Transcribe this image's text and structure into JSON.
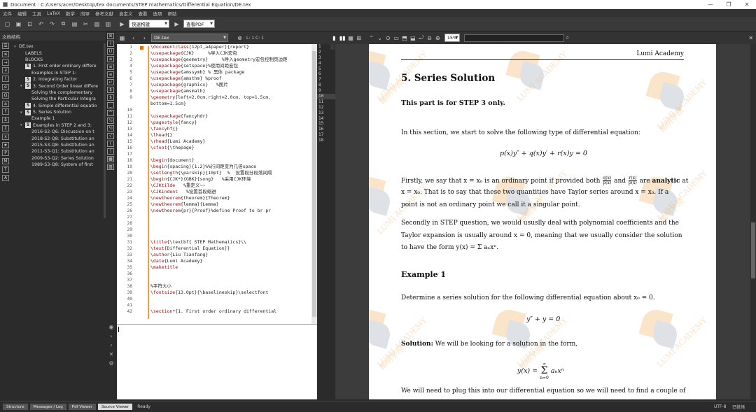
{
  "window": {
    "title": "Document : C:/Users/acer/Desktop/tex documents/STEP mathematics/Differential Equation/DE.tex"
  },
  "menu": [
    "文件",
    "编辑",
    "工具",
    "LaTeX",
    "数学",
    "向导",
    "参考文献",
    "自定义",
    "查看",
    "选项",
    "帮助"
  ],
  "toolbar": {
    "build_select": "快速构建",
    "view_select": "查看PDF"
  },
  "structure": {
    "header": "文档结构",
    "items": [
      {
        "level": 0,
        "caret": "▾",
        "icon": "",
        "label": "DE.tex"
      },
      {
        "level": 1,
        "caret": "",
        "icon": "",
        "label": "LABELS"
      },
      {
        "level": 1,
        "caret": "",
        "icon": "",
        "label": "BLOCKS"
      },
      {
        "level": 1,
        "caret": "",
        "icon": "S",
        "label": "1. First order ordinary differe"
      },
      {
        "level": 2,
        "caret": "",
        "icon": "",
        "label": "Examples in STEP 1:"
      },
      {
        "level": 1,
        "caret": "",
        "icon": "S",
        "label": "2. Integrating factor"
      },
      {
        "level": 1,
        "caret": "▾",
        "icon": "S",
        "label": "3. Second Order linear differe"
      },
      {
        "level": 2,
        "caret": "",
        "icon": "",
        "label": "Solving the complementary"
      },
      {
        "level": 2,
        "caret": "",
        "icon": "",
        "label": "Solving the Particular Integra"
      },
      {
        "level": 1,
        "caret": "",
        "icon": "S",
        "label": "4. Simple differential equatio"
      },
      {
        "level": 1,
        "caret": "▾",
        "icon": "S",
        "label": "5. Series Solution"
      },
      {
        "level": 2,
        "caret": "",
        "icon": "",
        "label": "Example 1"
      },
      {
        "level": 1,
        "caret": "▾",
        "icon": "S",
        "label": "Examples in STEP 2 and 3:"
      },
      {
        "level": 2,
        "caret": "",
        "icon": "",
        "label": "2016-S2-Q6: Discussion on t"
      },
      {
        "level": 2,
        "caret": "",
        "icon": "",
        "label": "2018-S2-Q8: Substitution an"
      },
      {
        "level": 2,
        "caret": "",
        "icon": "",
        "label": "2015-S3-Q8: Substitution an"
      },
      {
        "level": 2,
        "caret": "",
        "icon": "",
        "label": "2011-S3-Q1: Substitution an"
      },
      {
        "level": 2,
        "caret": "",
        "icon": "",
        "label": "2009-S3-Q2: Series Solution"
      },
      {
        "level": 2,
        "caret": "",
        "icon": "",
        "label": "1989-S3-Q8: System of first"
      }
    ]
  },
  "editor": {
    "tab": "DE.tex",
    "position": "L: 1 C: 1",
    "lines": [
      {
        "n": "1",
        "t": "\\documentclass[12pt,a4paper]{report}",
        "kw": true
      },
      {
        "n": "2",
        "t": "\\usepackage{CJK}     %导入CJK宏包",
        "kw": true
      },
      {
        "n": "3",
        "t": "\\usepackage{geometry}     %导入geometry宏包控制页边距",
        "kw": true
      },
      {
        "n": "4",
        "t": "\\usepackage{setspace}%使用间距宏包",
        "kw": true
      },
      {
        "n": "5",
        "t": "\\usepackage{amssymb} % 黑体 package",
        "kw": true
      },
      {
        "n": "6",
        "t": "\\usepackage{amsthm} %proof",
        "kw": true
      },
      {
        "n": "7",
        "t": "\\usepackage{graphicx}   %图片",
        "kw": true
      },
      {
        "n": "8",
        "t": "\\usepackage{amsmath}",
        "kw": true
      },
      {
        "n": "9",
        "t": "\\geometry{left=2.0cm,right=2.0cm, top=1.5cm,",
        "kw": true
      },
      {
        "n": "",
        "t": "bottom=1.5cm}",
        "kw": false
      },
      {
        "n": "10",
        "t": "",
        "kw": false
      },
      {
        "n": "11",
        "t": "\\usepackage{fancyhdr}",
        "kw": true
      },
      {
        "n": "12",
        "t": "\\pagestyle{fancy}",
        "kw": true
      },
      {
        "n": "13",
        "t": "\\fancyhf{}",
        "kw": true
      },
      {
        "n": "14",
        "t": "\\lhead{}",
        "kw": true
      },
      {
        "n": "15",
        "t": "\\rhead{Lumi Academy}",
        "kw": true
      },
      {
        "n": "16",
        "t": "\\cfoot{\\thepage}",
        "kw": true
      },
      {
        "n": "17",
        "t": "",
        "kw": false
      },
      {
        "n": "18",
        "t": "\\begin{document}",
        "kw": true
      },
      {
        "n": "19",
        "t": "\\begin{spacing}{1.2}%%行间距变为几倍space",
        "kw": true
      },
      {
        "n": "20",
        "t": "\\setlength{\\parskip}{10pt}  %  设置段分段落间隔",
        "kw": true
      },
      {
        "n": "21",
        "t": "\\begin{CJK*}{GBK}{song}   %采用CJK环境",
        "kw": true
      },
      {
        "n": "22",
        "t": "\\CJKtilde   %重定义~~",
        "kw": true
      },
      {
        "n": "23",
        "t": "\\CJKindent   %设置首段缩进",
        "kw": true
      },
      {
        "n": "24",
        "t": "\\newtheorem{theorem}{Theorem}",
        "kw": true
      },
      {
        "n": "25",
        "t": "\\newtheorem{lemma}{Lemma}",
        "kw": true
      },
      {
        "n": "26",
        "t": "\\newtheorem{pr}{Proof}%define Proof to br pr",
        "kw": true
      },
      {
        "n": "27",
        "t": "",
        "kw": false
      },
      {
        "n": "28",
        "t": "",
        "kw": false
      },
      {
        "n": "29",
        "t": "",
        "kw": false
      },
      {
        "n": "30",
        "t": "",
        "kw": false
      },
      {
        "n": "31",
        "t": "\\title{\\textbf{ STEP Mathematics}\\\\",
        "kw": true
      },
      {
        "n": "32",
        "t": "\\text{Differential Equation}}",
        "kw": true
      },
      {
        "n": "33",
        "t": "\\author{Liu Tianfang}",
        "kw": true
      },
      {
        "n": "34",
        "t": "\\date{Lumi Academy}",
        "kw": true
      },
      {
        "n": "35",
        "t": "\\maketitle",
        "kw": true
      },
      {
        "n": "36",
        "t": "",
        "kw": false
      },
      {
        "n": "37",
        "t": "",
        "kw": false
      },
      {
        "n": "38",
        "t": "%字符大小",
        "kw": false
      },
      {
        "n": "39",
        "t": "\\fontsize{13.0pt}{\\baselineskip}\\selectfont",
        "kw": true
      },
      {
        "n": "40",
        "t": "",
        "kw": false
      },
      {
        "n": "41",
        "t": "",
        "kw": false
      },
      {
        "n": "42",
        "t": "\\section*{1. First order ordinary differential",
        "kw": true
      }
    ]
  },
  "pdf_lines": [
    "1",
    "2",
    "3",
    "4",
    "5",
    "6",
    "7",
    "8",
    "9",
    "10",
    "11",
    "12",
    "13",
    "14",
    "15",
    "16",
    "17",
    "18"
  ],
  "pdf_toolbar": {
    "zoom": "15%"
  },
  "pdf": {
    "header": "Lumi Academy",
    "section": "5.  Series Solution",
    "intro_bold": "This part is for STEP 3 only.",
    "p1": "In this section, we start to solve the following type of differential equation:",
    "eq1": "p(x)y″ + q(x)y′ + r(x)y = 0",
    "p2a": "Firstly, we say that x = x₀ is an ordinary point if provided both",
    "frac1n": "q(x)",
    "frac1d": "p(x)",
    "p2and": "and",
    "frac2n": "r(x)",
    "frac2d": "p(x)",
    "p2are": "are",
    "p2bold": "analytic",
    "p2at": "at",
    "p2b": "x = x₀. That is to say that these two quantities have Taylor series around x = x₀. If a point is not an ordinary point we call it a singular point.",
    "p3": "Secondly in STEP question, we would ususlly deal with polynomial coefficients and the Taylor expansion is usually around x = 0, meaning that we usually consider the solution to have the form y(x) = Σ aₙxⁿ.",
    "example": "Example 1",
    "p4": "Determine a series solution for the following differential equation about x₀ = 0.",
    "eq2": "y″ + y = 0",
    "sol_bold": "Solution:",
    "sol": "We will be looking for a solution in the form,",
    "eq3_lhs": "y(x) =",
    "eq3_top": "∞",
    "eq3_sum": "Σ",
    "eq3_bot": "n=0",
    "eq3_rhs": "aₙxⁿ",
    "p5": "We will need to plug this into our differential equation so we will need to find a couple of",
    "watermark_en": "LUMI ACADEMY",
    "watermark_cn": "路明学院"
  },
  "status": {
    "tabs": [
      "Structure",
      "Messages / Log",
      "Pdf Viewer",
      "Source Viewer"
    ],
    "active_tab": "Source Viewer",
    "ready": "Ready",
    "encoding": "UTF-8",
    "mode": "已就绪"
  },
  "colors": {
    "accent_fold": "#f0a040",
    "keyword": "#b00000"
  }
}
